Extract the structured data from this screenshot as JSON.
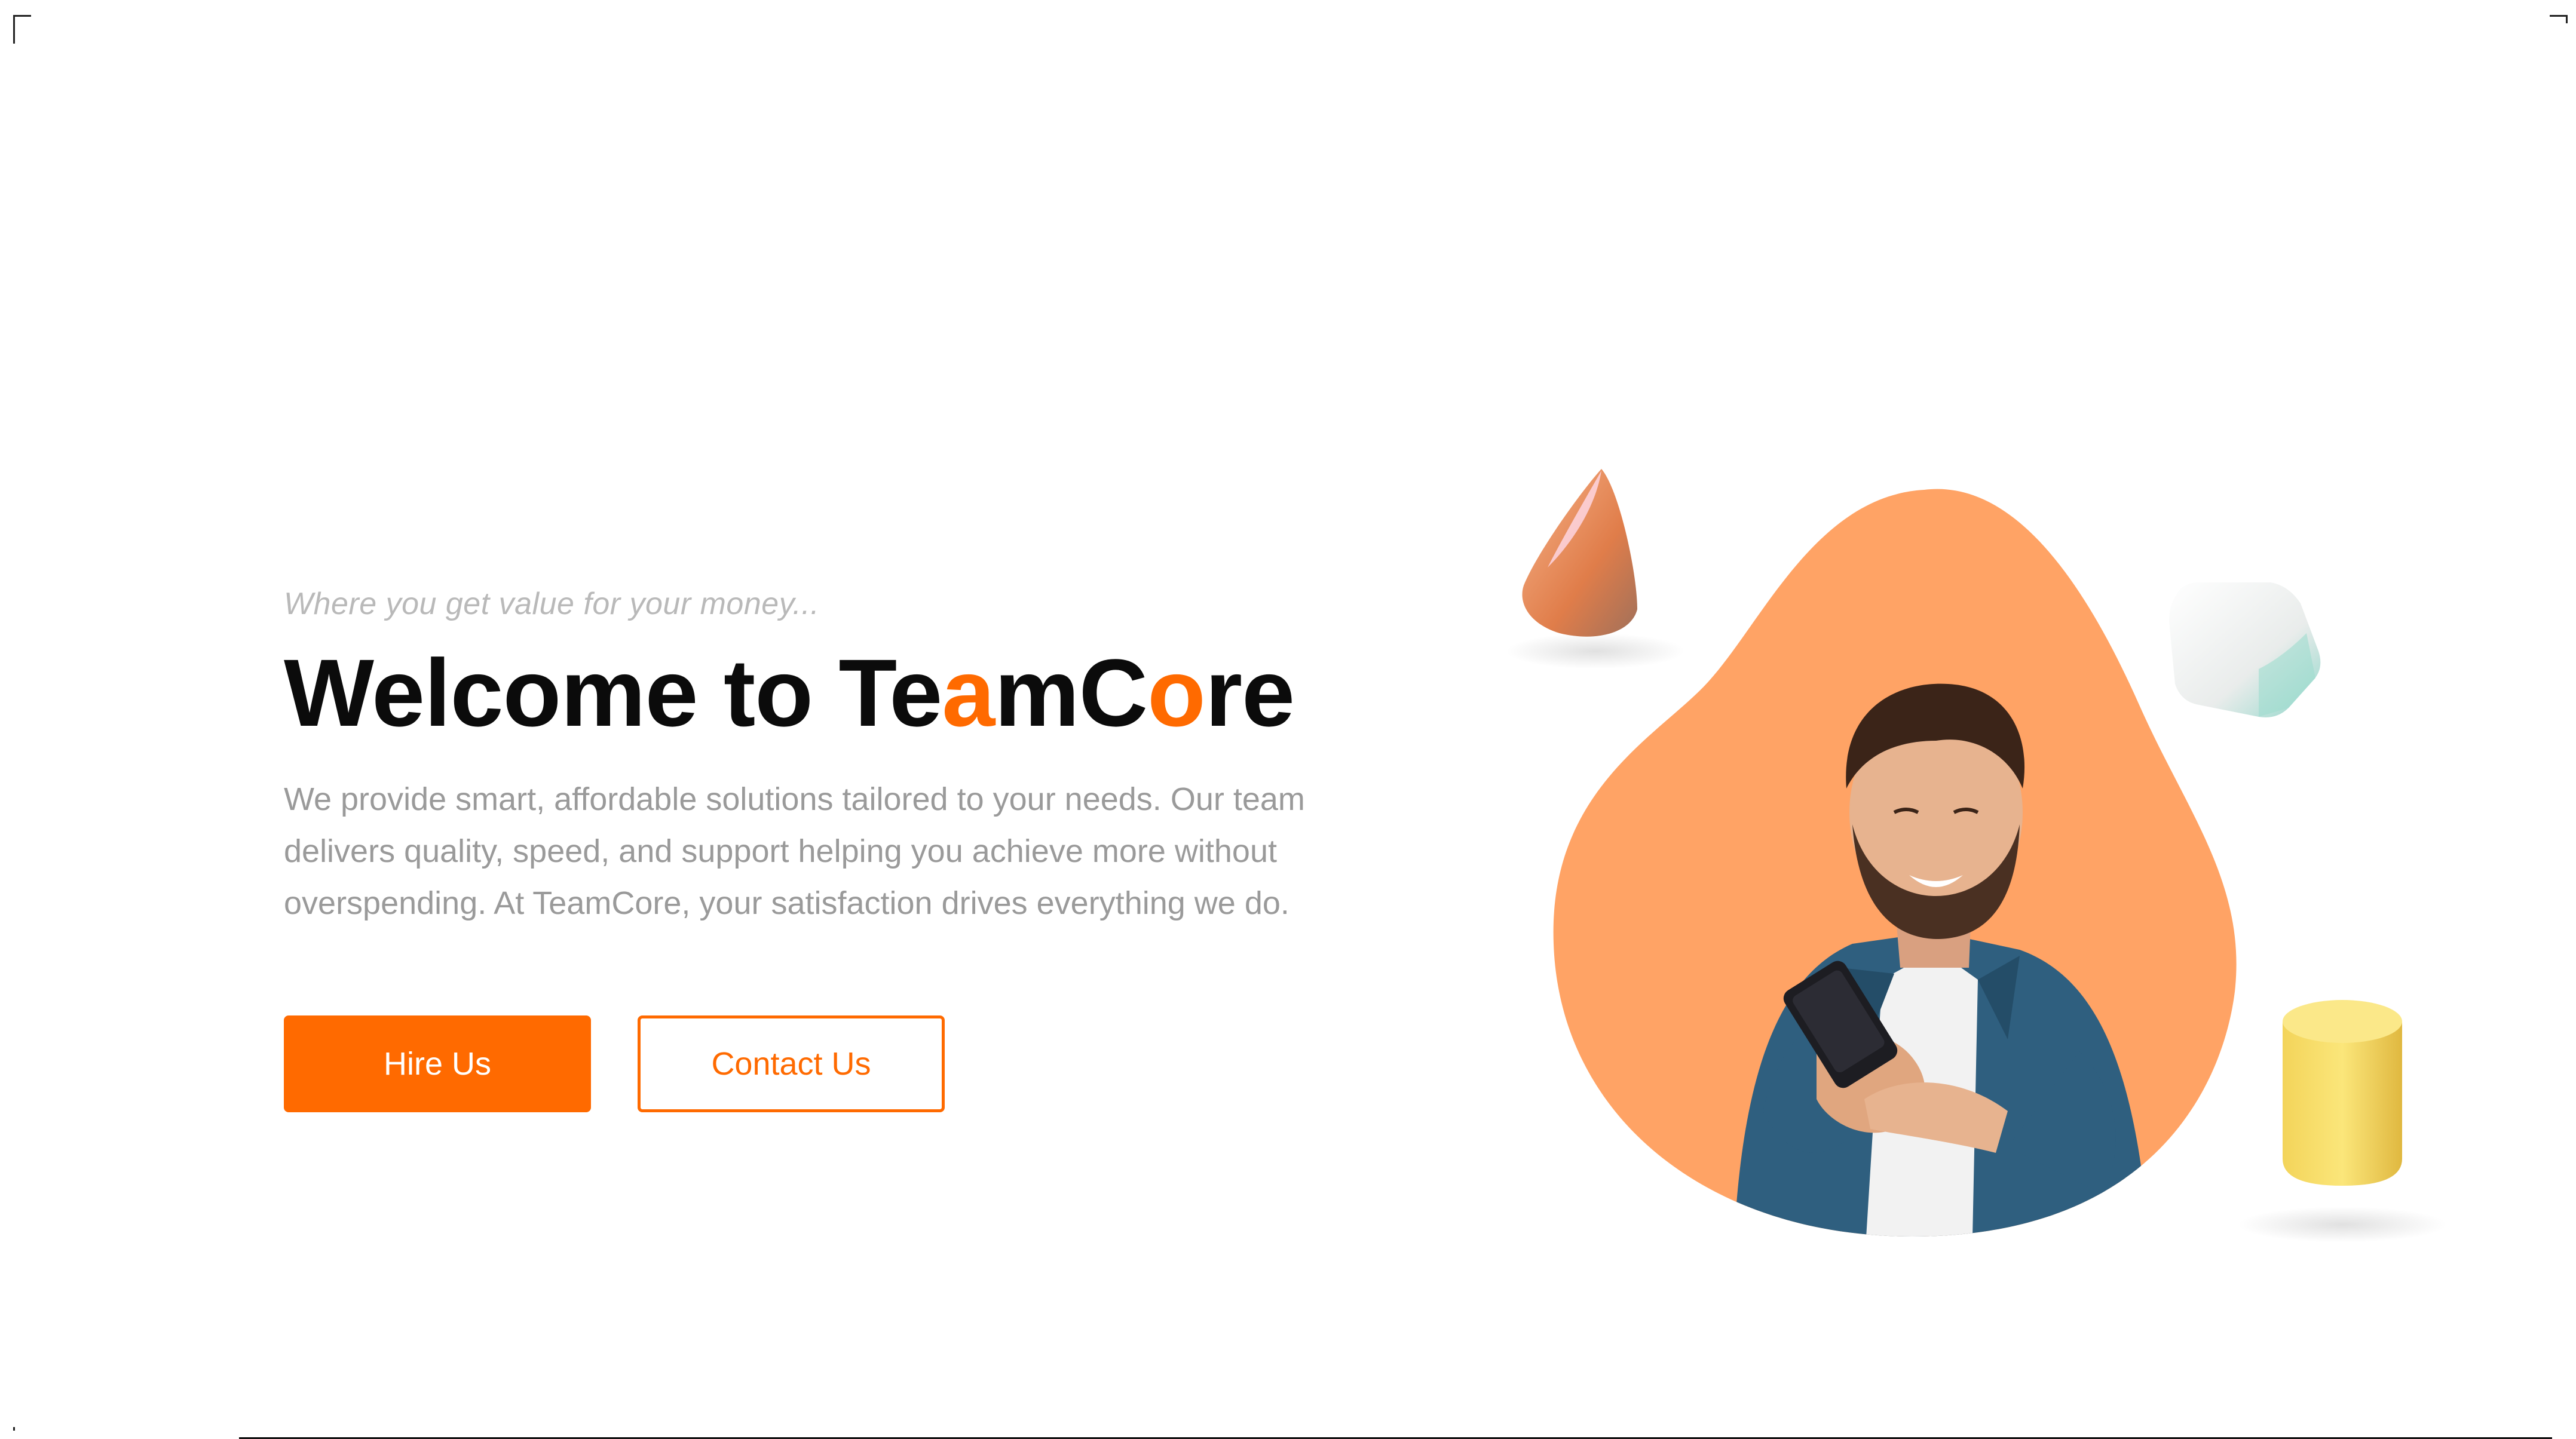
{
  "hero": {
    "tagline": "Where you get value for your money...",
    "headline": {
      "part1": "Welcome to Te",
      "accent1": "a",
      "part2": "mC",
      "accent2": "o",
      "part3": "re"
    },
    "description": "We provide smart, affordable solutions tailored to your needs. Our team delivers quality, speed, and support helping you achieve more without overspending. At TeamCore, your satisfaction drives everything we do."
  },
  "buttons": {
    "hire_label": "Hire Us",
    "contact_label": "Contact Us"
  },
  "colors": {
    "accent": "#ff6a00",
    "blob": "#ffa365",
    "heading": "#0b0b0b",
    "muted_text": "#9a9a9a",
    "tagline": "#b9b9b9"
  },
  "icons": [
    "cone-3d-shape",
    "cube-3d-shape",
    "cylinder-3d-shape",
    "person-with-phone-image"
  ]
}
